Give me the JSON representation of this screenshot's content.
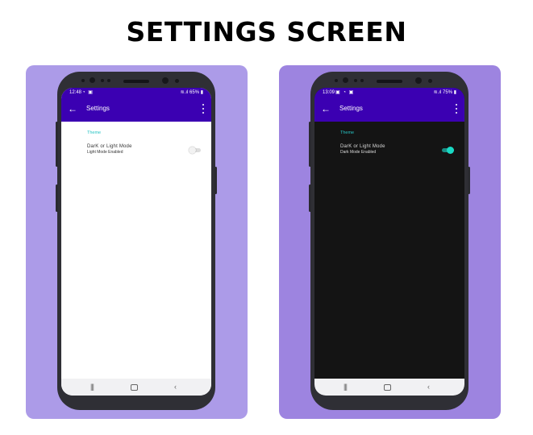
{
  "page_title": "SETTINGS SCREEN",
  "colors": {
    "left_panel": "#ac9be8",
    "right_panel": "#9d84e0",
    "app_bar": "#3b00b2",
    "accent_teal": "#27c4c4",
    "dark_background": "#141414"
  },
  "phones": {
    "light": {
      "status": {
        "time": "12:48",
        "icons": "◔ ▣",
        "battery": "65%"
      },
      "appbar": {
        "back_icon": "arrow-left-icon",
        "title": "Settings",
        "menu_icon": "more-vert-icon"
      },
      "section": "Theme",
      "pref": {
        "title": "DarK or Light Mode",
        "subtitle": "Light Mode Enabled",
        "enabled": false
      },
      "nav": {
        "recents": "|||",
        "back": "‹"
      }
    },
    "dark": {
      "status": {
        "time": "13:09",
        "icons": "▣ ◔ ▣",
        "battery": "75%"
      },
      "appbar": {
        "back_icon": "arrow-left-icon",
        "title": "Settings",
        "menu_icon": "more-vert-icon"
      },
      "section": "Theme",
      "pref": {
        "title": "DarK or Light Mode",
        "subtitle": "Dark Mode Enabled",
        "enabled": true
      },
      "nav": {
        "recents": "|||",
        "back": "‹"
      }
    }
  }
}
